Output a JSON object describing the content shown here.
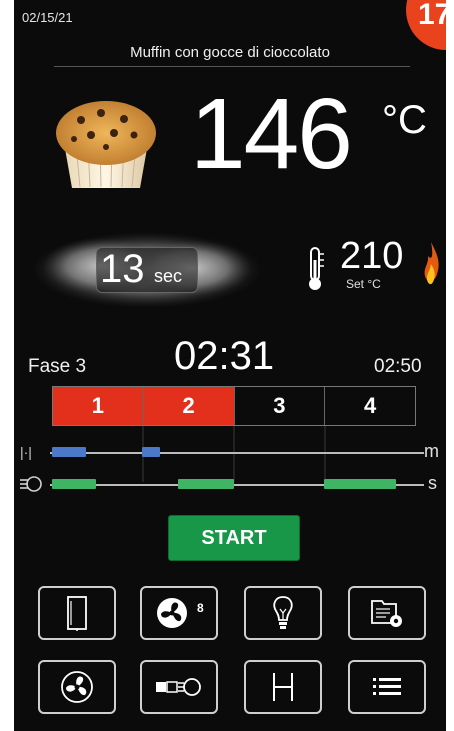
{
  "corner_badge": "17",
  "date": "02/15/21",
  "recipe_title": "Muffin con gocce di cioccolato",
  "chamber_temp": {
    "value": "146",
    "unit": "°C"
  },
  "steam": {
    "value": "13",
    "unit": "sec"
  },
  "setpoint": {
    "value": "210",
    "label": "Set °C"
  },
  "phase": {
    "label": "Fase 3",
    "elapsed": "02:31",
    "total": "02:50"
  },
  "phases": [
    {
      "label": "1",
      "active": true
    },
    {
      "label": "2",
      "active": true
    },
    {
      "label": "3",
      "active": false
    },
    {
      "label": "4",
      "active": false
    }
  ],
  "tracks": {
    "fan_unit": "m",
    "steam_unit": "s"
  },
  "start_button": "START",
  "toolbar": {
    "fan_speed": "8"
  },
  "icons": [
    "oven-door-icon",
    "fan-speed-icon",
    "light-bulb-icon",
    "settings-folder-icon",
    "fan-icon",
    "steam-valve-icon",
    "hold-icon",
    "menu-icon"
  ],
  "colors": {
    "background": "#0b0b0b",
    "active_phase": "#e2301c",
    "start": "#189748",
    "fan_track": "#4b79c9",
    "steam_track": "#3fb464"
  }
}
